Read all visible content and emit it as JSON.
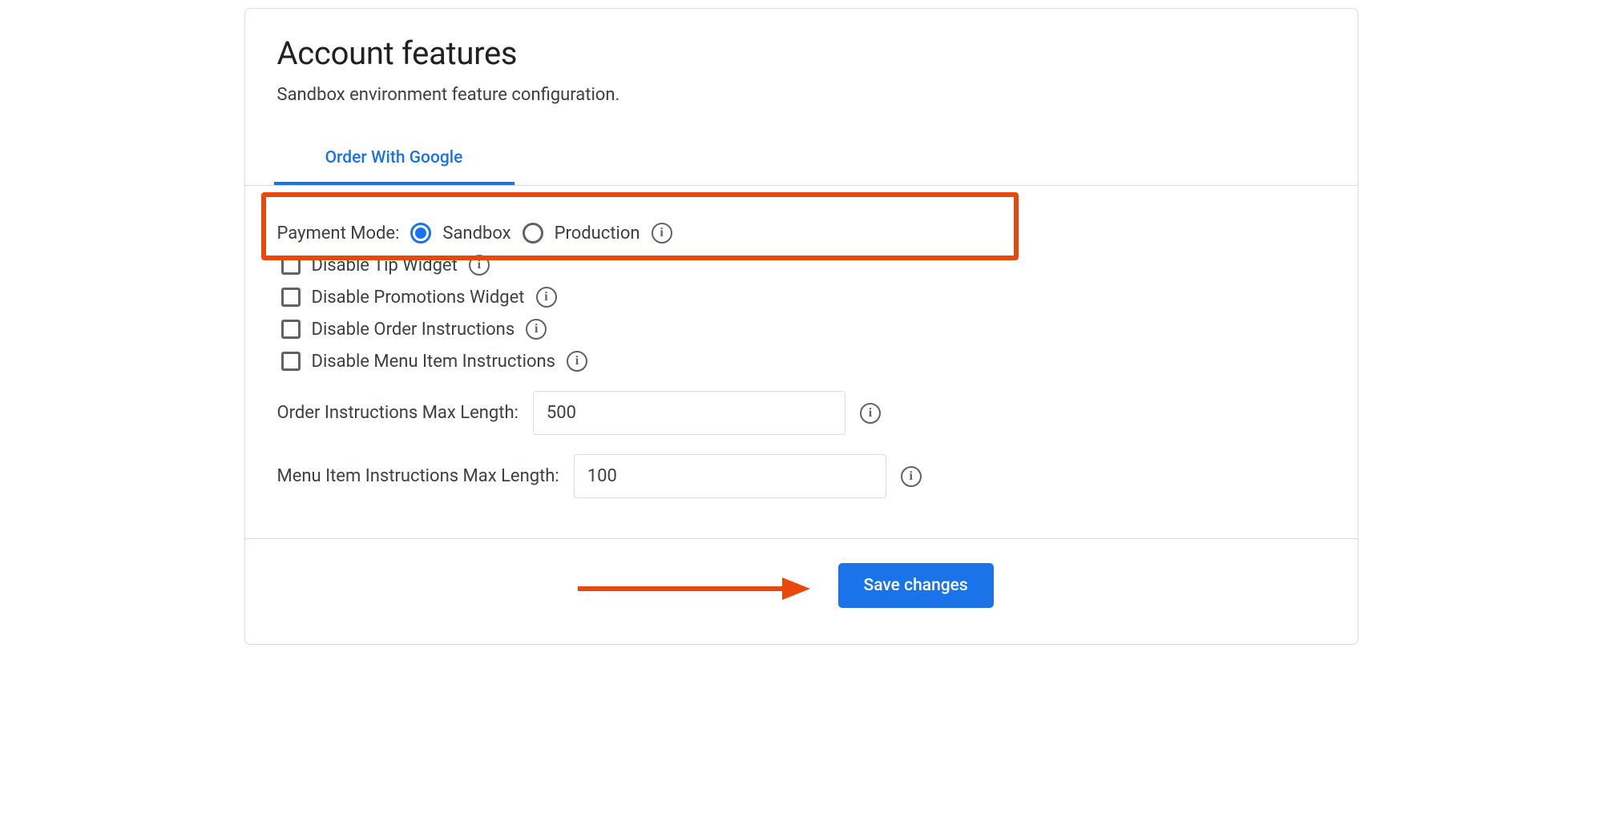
{
  "header": {
    "title": "Account features",
    "subtitle": "Sandbox environment feature configuration."
  },
  "tabs": {
    "active": "Order With Google"
  },
  "paymentMode": {
    "label": "Payment Mode:",
    "option1": "Sandbox",
    "option2": "Production",
    "selected": "Sandbox"
  },
  "checkboxes": {
    "tipWidget": "Disable Tip Widget",
    "promoWidget": "Disable Promotions Widget",
    "orderInstructions": "Disable Order Instructions",
    "menuItemInstructions": "Disable Menu Item Instructions"
  },
  "inputs": {
    "orderMax": {
      "label": "Order Instructions Max Length:",
      "value": "500"
    },
    "menuMax": {
      "label": "Menu Item Instructions Max Length:",
      "value": "100"
    }
  },
  "footer": {
    "save": "Save changes"
  }
}
